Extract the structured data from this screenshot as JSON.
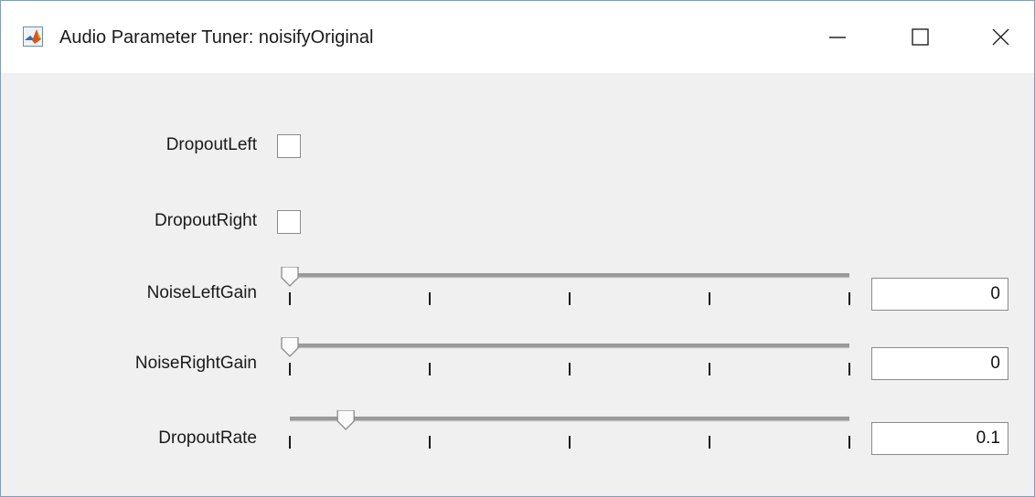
{
  "window": {
    "title": "Audio Parameter Tuner: noisifyOriginal",
    "icon": "matlab-logo-icon"
  },
  "controls": {
    "dropout_left": {
      "label": "DropoutLeft",
      "checked": false
    },
    "dropout_right": {
      "label": "DropoutRight",
      "checked": false
    },
    "noise_left_gain": {
      "label": "NoiseLeftGain",
      "value": "0",
      "fraction": 0.0
    },
    "noise_right_gain": {
      "label": "NoiseRightGain",
      "value": "0",
      "fraction": 0.0
    },
    "dropout_rate": {
      "label": "DropoutRate",
      "value": "0.1",
      "fraction": 0.1
    }
  }
}
